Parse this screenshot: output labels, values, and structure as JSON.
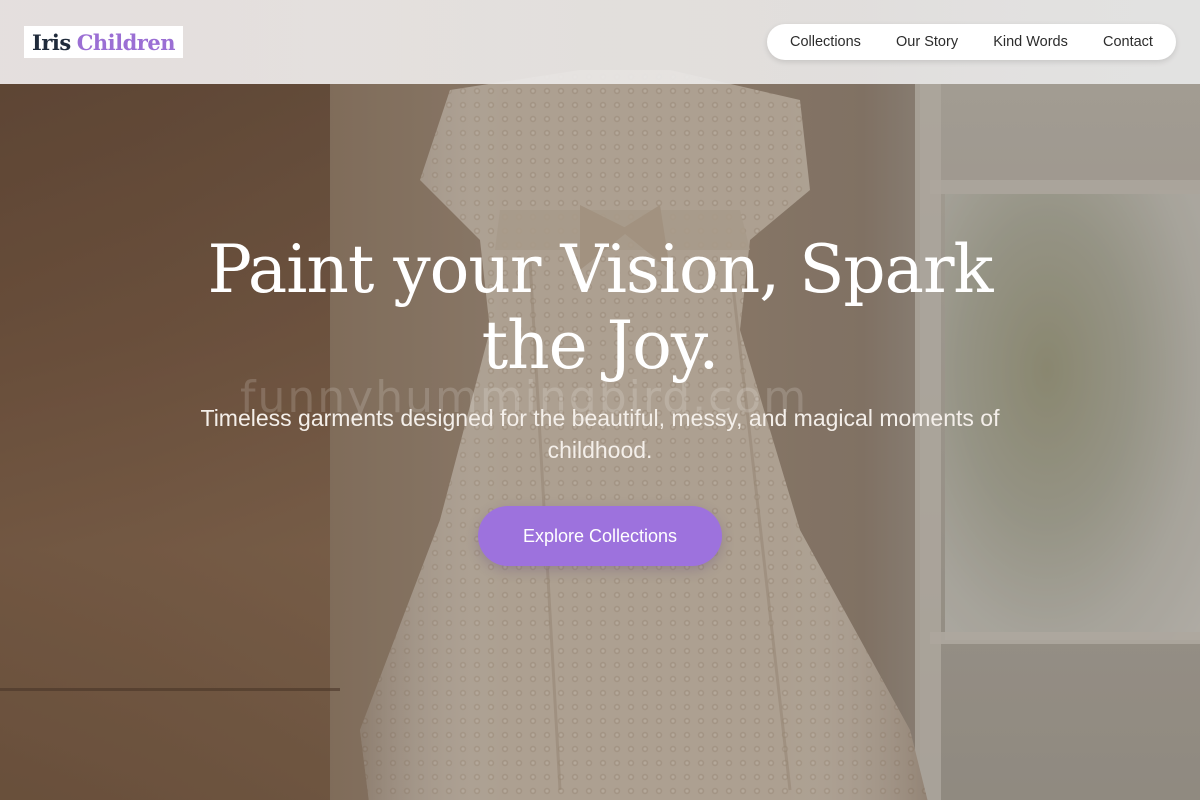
{
  "brand": {
    "word1": "Iris",
    "word2": "Children"
  },
  "nav": {
    "items": [
      {
        "label": "Collections"
      },
      {
        "label": "Our Story"
      },
      {
        "label": "Kind Words"
      },
      {
        "label": "Contact"
      }
    ]
  },
  "hero": {
    "headline_line1": "Paint your Vision, Spark",
    "headline_line2": "the Joy.",
    "subtext": "Timeless garments designed for the beautiful, messy, and magical moments of childhood.",
    "cta_label": "Explore Collections",
    "watermark": "funnyhummingbird.com"
  },
  "colors": {
    "accent": "#9d72dd",
    "logo_dark": "#1f2a3a",
    "logo_accent": "#9b6fd4"
  }
}
